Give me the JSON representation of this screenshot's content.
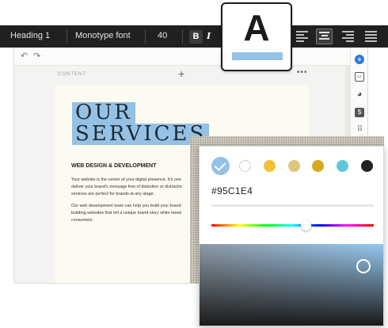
{
  "toolbar": {
    "heading_style": "Heading 1",
    "font_name": "Monotype font",
    "font_size": "40",
    "bold_label": "B",
    "italic_label": "I",
    "alignment_selected": "center",
    "align_icons": [
      "align-left-icon",
      "align-center-icon",
      "align-right-icon",
      "align-justify-icon"
    ]
  },
  "color_button": {
    "letter": "A",
    "current_color": "#95C1E4"
  },
  "editor": {
    "undo_icon": "↶",
    "redo_icon": "↷",
    "section_label": "CONTENT",
    "add_icon": "+",
    "more_icon": "•••",
    "rail_icons": [
      "plus-circle-icon",
      "embed-icon",
      "palette-icon",
      "dollar-icon",
      "grid-icon"
    ],
    "rail_glyphs": [
      "+",
      "▭",
      "◕",
      "$",
      "⠿"
    ]
  },
  "page": {
    "title_line_1": "OUR",
    "title_line_2": "SERVICES",
    "subheading": "WEB DESIGN & DEVELOPMENT",
    "paragraph_1": [
      "Your website is the center of your digital presence. It's one",
      "deliver your brand's message free of distortion or distractio",
      "services are perfect for brands at any stage."
    ],
    "paragraph_2": [
      "Our web development team can help you build your brand",
      "building websites that tell a unique brand story while meeti",
      "consumers."
    ]
  },
  "color_picker": {
    "hex_value": "#95C1E4",
    "swatches": [
      "#95C1E4",
      "#FFFFFF",
      "#F1C232",
      "#DCC67C",
      "#D4A91B",
      "#5BC8D6",
      "#222222"
    ],
    "selected_swatch": "#95C1E4",
    "hue_position": 0.6
  }
}
